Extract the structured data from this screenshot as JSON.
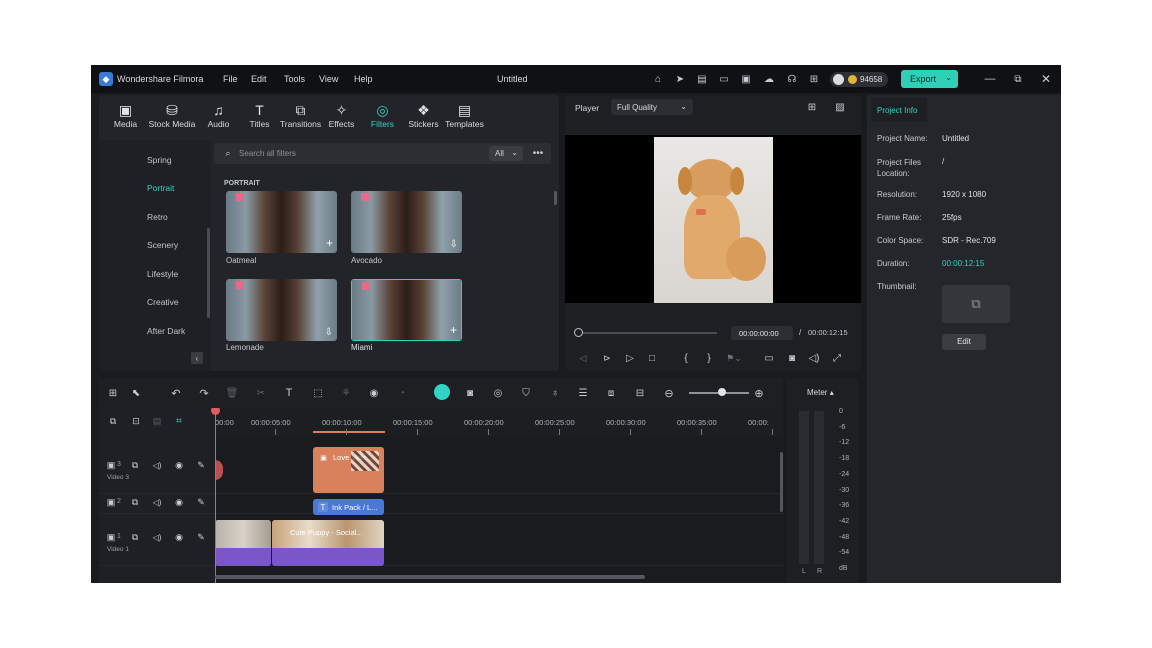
{
  "app": {
    "title": "Wondershare Filmora",
    "menus": [
      "File",
      "Edit",
      "Tools",
      "View",
      "Help"
    ],
    "project_title": "Untitled",
    "credits": "94658",
    "export_label": "Export"
  },
  "toolbar": {
    "tools": [
      {
        "label": "Media",
        "icon": "media-icon",
        "glyph": "▣"
      },
      {
        "label": "Stock Media",
        "icon": "stock-media-icon",
        "glyph": "⛁"
      },
      {
        "label": "Audio",
        "icon": "audio-icon",
        "glyph": "♫"
      },
      {
        "label": "Titles",
        "icon": "titles-icon",
        "glyph": "T"
      },
      {
        "label": "Transitions",
        "icon": "transitions-icon",
        "glyph": "⧉"
      },
      {
        "label": "Effects",
        "icon": "effects-icon",
        "glyph": "✧"
      },
      {
        "label": "Filters",
        "icon": "filters-icon",
        "glyph": "◎"
      },
      {
        "label": "Stickers",
        "icon": "stickers-icon",
        "glyph": "❖"
      },
      {
        "label": "Templates",
        "icon": "templates-icon",
        "glyph": "▤"
      }
    ],
    "active": "Filters"
  },
  "filters": {
    "categories": [
      "Spring",
      "Portrait",
      "Retro",
      "Scenery",
      "Lifestyle",
      "Creative",
      "After Dark"
    ],
    "active_category": "Portrait",
    "search_placeholder": "Search all filters",
    "dropdown": "All",
    "section_title": "PORTRAIT",
    "items": [
      {
        "name": "Oatmeal"
      },
      {
        "name": "Avocado"
      },
      {
        "name": "Lemonade"
      },
      {
        "name": "Miami"
      }
    ]
  },
  "player": {
    "label": "Player",
    "quality": "Full Quality",
    "current_time": "00:00:00:00",
    "total_time": "00:00:12:15",
    "separator": "/"
  },
  "project_info": {
    "tab": "Project Info",
    "rows": [
      {
        "label": "Project Name:",
        "value": "Untitled"
      },
      {
        "label": "Project Files Location:",
        "value": "/"
      },
      {
        "label": "Resolution:",
        "value": "1920 x 1080"
      },
      {
        "label": "Frame Rate:",
        "value": "25fps"
      },
      {
        "label": "Color Space:",
        "value": "SDR - Rec.709"
      },
      {
        "label": "Duration:",
        "value": "00:00:12:15"
      }
    ],
    "thumbnail_label": "Thumbnail:",
    "edit_label": "Edit"
  },
  "timeline": {
    "ruler": [
      "00:00",
      "00:00:05:00",
      "00:00:10:00",
      "00:00:15:00",
      "00:00:20:00",
      "00:00:25:00",
      "00:00:30:00",
      "00:00:35:00",
      "00:00:"
    ],
    "tracks": [
      {
        "num": "3",
        "name": "Video 3"
      },
      {
        "num": "2",
        "name": ""
      },
      {
        "num": "1",
        "name": "Video 1"
      }
    ],
    "clips": {
      "love": "Love Vide...",
      "inkpack": "Ink Pack / L...",
      "main": "Cute Puppy - Social..."
    }
  },
  "meter": {
    "label": "Meter",
    "scale": [
      "0",
      "-6",
      "-12",
      "-18",
      "-24",
      "-30",
      "-36",
      "-42",
      "-48",
      "-54",
      "dB"
    ],
    "channels": [
      "L",
      "R"
    ]
  },
  "colors": {
    "accent": "#2fd4c4",
    "export": "#2ed1b8",
    "clip_orange": "#d9805c",
    "clip_purple": "#7a56c8",
    "clip_blue": "#4a78d8",
    "playhead": "#e35b5b"
  }
}
